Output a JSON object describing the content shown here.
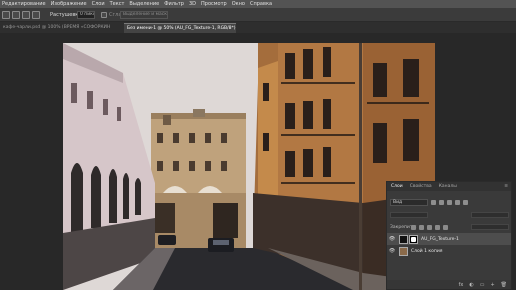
{
  "menu": [
    "Редактирование",
    "Изображение",
    "Слои",
    "Текст",
    "Выделение",
    "Фильтр",
    "3D",
    "Просмотр",
    "Окно",
    "Справка"
  ],
  "options": {
    "feather_label": "Растушевка:",
    "feather_value": "0 пикс.",
    "smoothing_label": "Сглаживание",
    "select_mask_label": "Выделение и маска..."
  },
  "tabs": {
    "inactive": "кафе-чарли.psd @ 100% (ВРЕМЯ «СОФОРКИНГ», RGB/8)",
    "active": "Без имени-1 @ 50% (AU_FG_Texture-1, RGB/8*)",
    "close": "×"
  },
  "layers_panel": {
    "tabs": [
      "Слои",
      "Свойства",
      "Каналы"
    ],
    "active_tab": "Слои",
    "menu_icon": "≡",
    "kind_filter": "Вид",
    "lock_label": "Закрепить:",
    "eye_glyph": "👁",
    "layers": [
      {
        "name": "AU_FG_Texture-1",
        "selected": true,
        "has_mask": true
      },
      {
        "name": "Слой 1 копия",
        "selected": false,
        "has_mask": false
      }
    ],
    "bottom_icons": [
      "fx",
      "◐",
      "▭",
      "+",
      "🗑"
    ]
  }
}
